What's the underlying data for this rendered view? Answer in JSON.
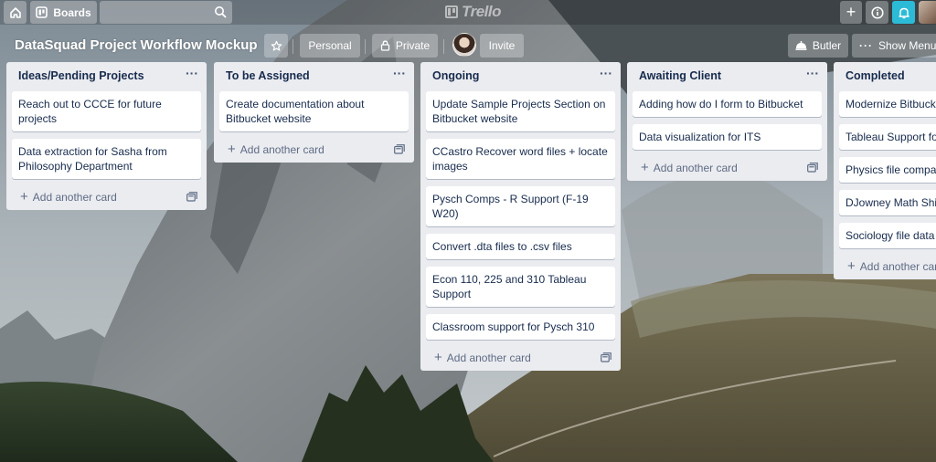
{
  "topbar": {
    "home_icon": "home-icon",
    "boards_label": "Boards",
    "search_placeholder": "",
    "logo_text": "Trello",
    "plus_label": "+",
    "info_icon": "info-icon",
    "bell_icon": "bell-icon",
    "bell_color": "#2cbbd6"
  },
  "board": {
    "title": "DataSquad Project Workflow Mockup",
    "star_icon": "star-icon",
    "personal_label": "Personal",
    "private_label": "Private",
    "invite_label": "Invite",
    "butler_label": "Butler",
    "show_menu_label": "Show Menu"
  },
  "lists": [
    {
      "title": "Ideas/Pending Projects",
      "cards": [
        "Reach out to CCCE for future projects",
        "Data extraction for Sasha from Philosophy Department"
      ],
      "add_label": "Add another card"
    },
    {
      "title": "To be Assigned",
      "cards": [
        "Create documentation about Bitbucket website"
      ],
      "add_label": "Add another card"
    },
    {
      "title": "Ongoing",
      "cards": [
        "Update Sample Projects Section on Bitbucket website",
        "CCastro Recover word files + locate images",
        "Pysch Comps - R Support (F-19 W20)",
        "Convert .dta files to .csv files",
        "Econ 110, 225 and 310 Tableau Support",
        "Classroom support for Pysch 310"
      ],
      "add_label": "Add another card"
    },
    {
      "title": "Awaiting Client",
      "cards": [
        "Adding how do I form to Bitbucket",
        "Data visualization for ITS"
      ],
      "add_label": "Add another card"
    },
    {
      "title": "Completed",
      "cards": [
        "Modernize Bitbucket",
        "Tableau Support fo",
        "Physics file compar",
        "DJowney Math Shin",
        "Sociology file data"
      ],
      "add_label": "Add another car"
    }
  ],
  "colors": {
    "list_bg": "#ebecf0",
    "card_bg": "#ffffff",
    "text": "#172b4d",
    "muted": "#5e6c84"
  }
}
